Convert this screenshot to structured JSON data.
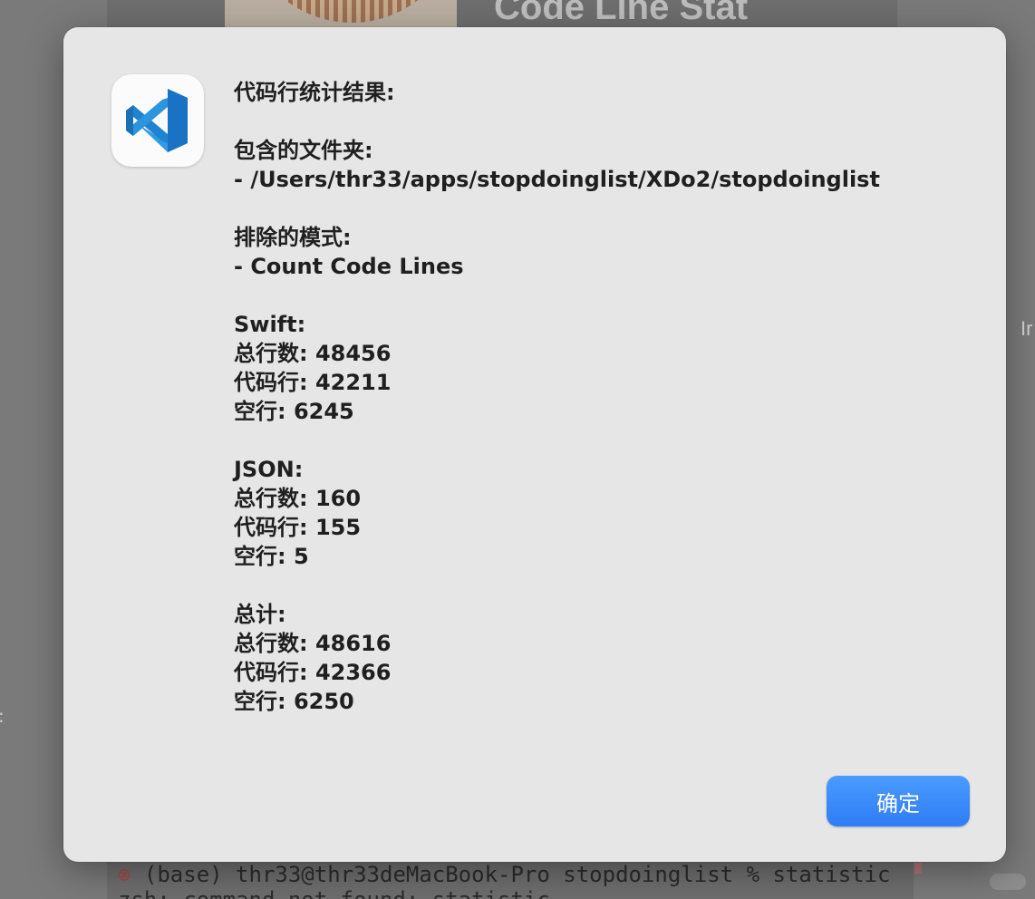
{
  "background": {
    "title": "Code Line Stat",
    "side_text": "Ir",
    "left_char": ":",
    "terminal": {
      "error_icon": "⊗",
      "line1": " (base) thr33@thr33deMacBook-Pro stopdoinglist % statistic",
      "line2": "zsh: command not found: statistic"
    }
  },
  "dialog": {
    "app_icon": "vscode-icon",
    "lines": [
      "代码行统计结果:",
      "",
      "包含的文件夹:",
      "- /Users/thr33/apps/stopdoinglist/XDo2/stopdoinglist",
      "",
      "排除的模式:",
      "- Count Code Lines",
      "",
      "Swift:",
      "总行数: 48456",
      "代码行: 42211",
      "空行: 6245",
      "",
      "JSON:",
      "总行数: 160",
      "代码行: 155",
      "空行: 5",
      "",
      "总计:",
      "总行数: 48616",
      "代码行: 42366",
      "空行: 6250"
    ],
    "confirm_label": "确定"
  },
  "colors": {
    "accent": "#3b86f9",
    "dialog_bg": "#e6e6e6",
    "vscode_blue": "#1f8ad2"
  }
}
